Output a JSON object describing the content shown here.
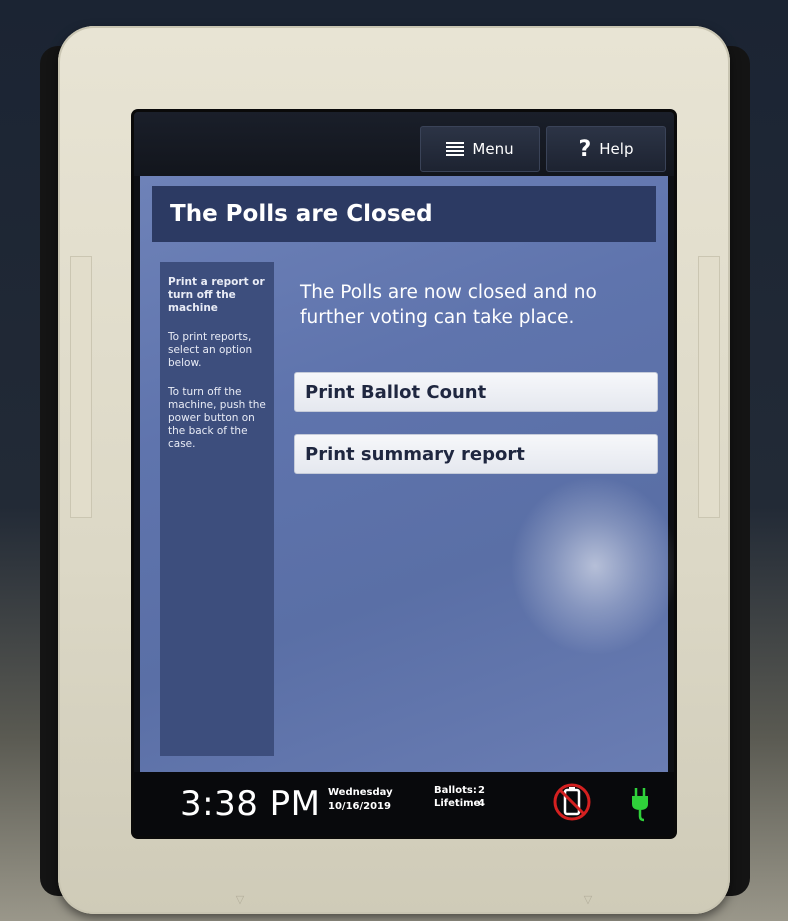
{
  "topbar": {
    "menu_label": "Menu",
    "help_label": "Help",
    "menu_icon": "hamburger-icon",
    "help_icon": "question-mark-icon",
    "help_glyph": "?"
  },
  "title": "The Polls are Closed",
  "sidebar": {
    "heading": "Print a report or turn off the machine",
    "print_text": "To print reports, select an option below.",
    "power_text": "To turn off the machine, push the power button on the back of the case."
  },
  "main": {
    "message": "The Polls are now closed and no further voting can take place.",
    "buttons": [
      {
        "label": "Print Ballot Count"
      },
      {
        "label": "Print summary report"
      }
    ]
  },
  "status": {
    "time": "3:38 PM",
    "day": "Wednesday",
    "date": "10/16/2019",
    "ballots_label": "Ballots:",
    "ballots_value": "2",
    "lifetime_label": "Lifetime:",
    "lifetime_value": "4",
    "battery_icon": "no-battery-icon",
    "power_icon": "power-plug-icon"
  },
  "colors": {
    "app_bg": "#6277ae",
    "title_bg": "#2c3a63",
    "sidebar_bg": "#3d4e7d",
    "no_battery_red": "#d42020",
    "plug_green": "#2fd13a"
  }
}
